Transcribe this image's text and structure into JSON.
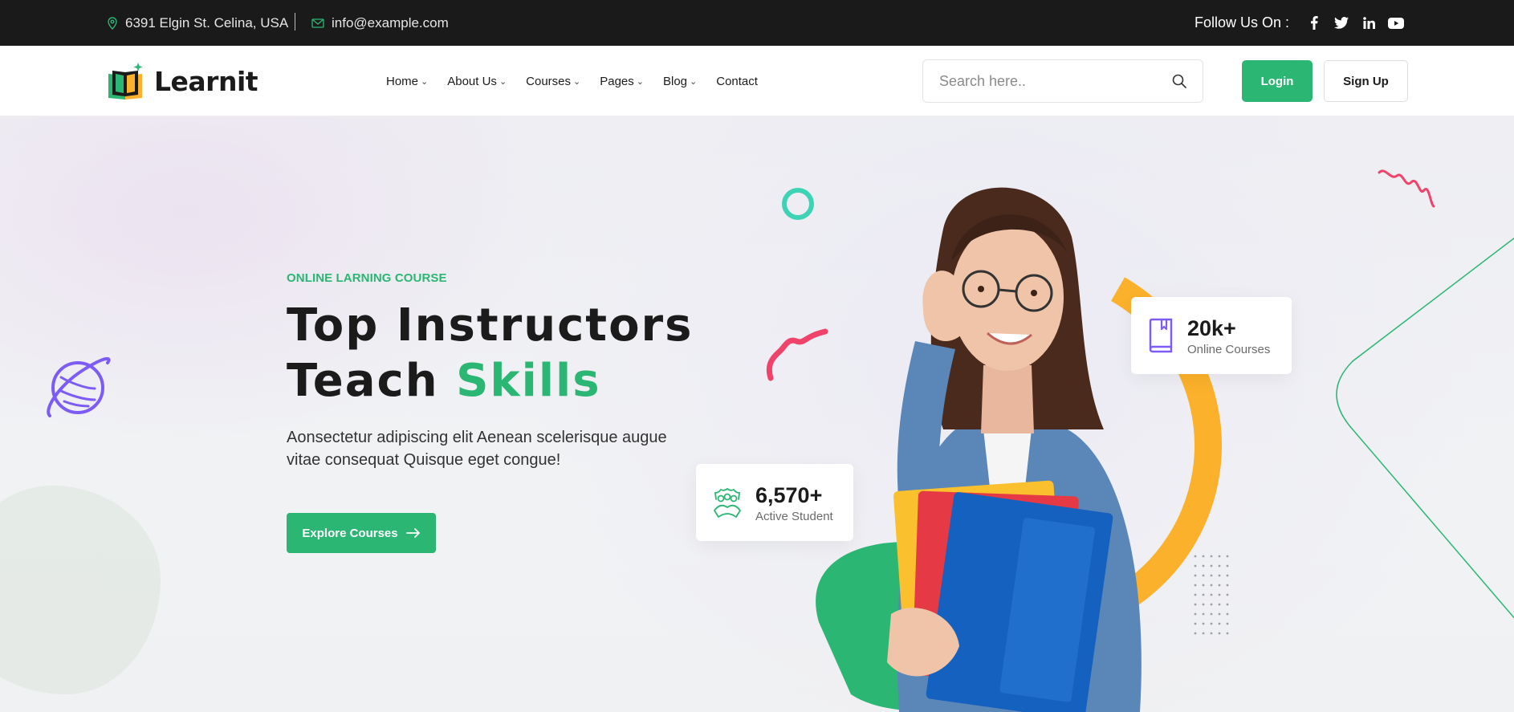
{
  "topbar": {
    "address": "6391 Elgin St. Celina, USA",
    "email": "info@example.com",
    "follow_label": "Follow Us On :",
    "social_icons": [
      "facebook-icon",
      "twitter-icon",
      "linkedin-icon",
      "youtube-icon"
    ]
  },
  "header": {
    "brand": "Learnit",
    "nav": [
      {
        "label": "Home",
        "dropdown": true
      },
      {
        "label": "About Us",
        "dropdown": true
      },
      {
        "label": "Courses",
        "dropdown": true
      },
      {
        "label": "Pages",
        "dropdown": true
      },
      {
        "label": "Blog",
        "dropdown": true
      },
      {
        "label": "Contact",
        "dropdown": false
      }
    ],
    "search": {
      "placeholder": "Search here.."
    },
    "login_label": "Login",
    "signup_label": "Sign Up"
  },
  "hero": {
    "eyebrow": "ONLINE LARNING COURSE",
    "title_line1": "Top Instructors",
    "title_line2_plain": "Teach ",
    "title_line2_accent": "Skills",
    "description": "Aonsectetur adipiscing elit Aenean scelerisque augue vitae consequat Quisque eget congue!",
    "cta_label": "Explore Courses",
    "stats": [
      {
        "value": "20k+",
        "label": "Online Courses",
        "icon": "book-icon"
      },
      {
        "value": "6,570+",
        "label": "Active Student",
        "icon": "students-icon"
      }
    ]
  },
  "colors": {
    "accent": "#2bb673",
    "dark": "#1a1a1a",
    "pink": "#f0436b",
    "orange": "#fbb12b",
    "purple": "#7c5cf5",
    "teal": "#3fd3b6"
  }
}
